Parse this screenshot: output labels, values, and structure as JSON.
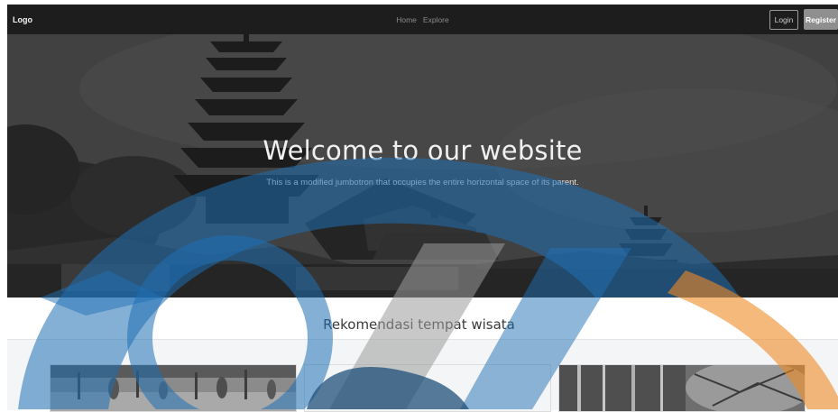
{
  "navbar": {
    "logo": "Logo",
    "links": [
      "Home",
      "Explore"
    ],
    "login_label": "Login",
    "register_label": "Register"
  },
  "hero": {
    "title": "Welcome to our website",
    "subtitle": "This is a modified jumbotron that occupies the entire horizontal space of its parent."
  },
  "recommendations": {
    "title": "Rekomendasi tempat wisata"
  },
  "colors": {
    "navbar_bg": "#1d1d1d",
    "register_bg": "#8f8f8f",
    "watermark_blue": "#1f6fb4",
    "watermark_orange": "#f08a24"
  }
}
